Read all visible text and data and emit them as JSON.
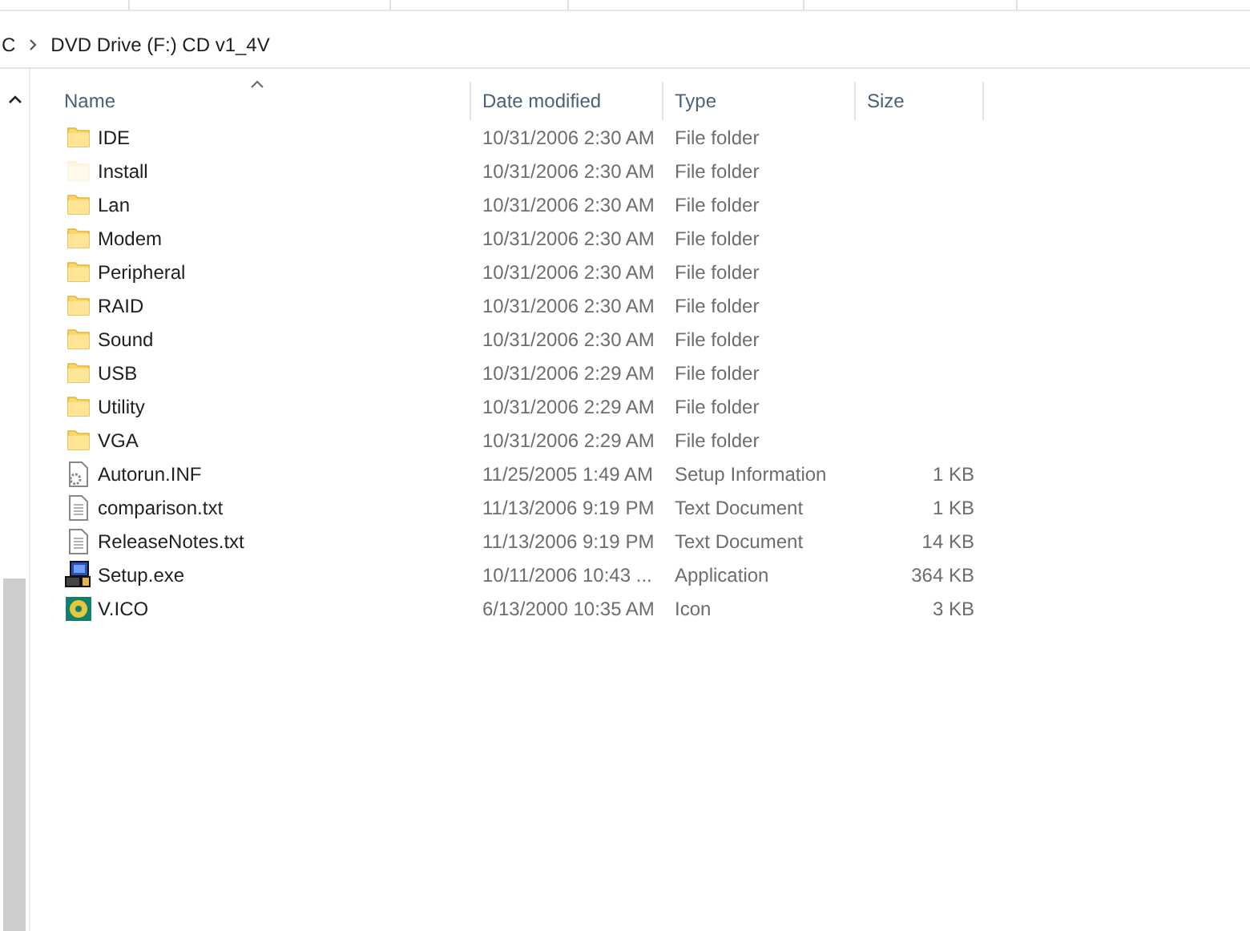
{
  "address_bar": {
    "segments": [
      "C",
      "DVD Drive (F:) CD v1_4V"
    ]
  },
  "columns": [
    {
      "label": "Name",
      "sorted": true
    },
    {
      "label": "Date modified",
      "sorted": false
    },
    {
      "label": "Type",
      "sorted": false
    },
    {
      "label": "Size",
      "sorted": false
    }
  ],
  "files": [
    {
      "kind": "folder",
      "name": "IDE",
      "date": "10/31/2006 2:30 AM",
      "type": "File folder",
      "hidden": false
    },
    {
      "kind": "folder",
      "name": "Install",
      "date": "10/31/2006 2:30 AM",
      "type": "File folder",
      "hidden": true
    },
    {
      "kind": "folder",
      "name": "Lan",
      "date": "10/31/2006 2:30 AM",
      "type": "File folder",
      "hidden": false
    },
    {
      "kind": "folder",
      "name": "Modem",
      "date": "10/31/2006 2:30 AM",
      "type": "File folder",
      "hidden": false
    },
    {
      "kind": "folder",
      "name": "Peripheral",
      "date": "10/31/2006 2:30 AM",
      "type": "File folder",
      "hidden": false
    },
    {
      "kind": "folder",
      "name": "RAID",
      "date": "10/31/2006 2:30 AM",
      "type": "File folder",
      "hidden": false
    },
    {
      "kind": "folder",
      "name": "Sound",
      "date": "10/31/2006 2:30 AM",
      "type": "File folder",
      "hidden": false
    },
    {
      "kind": "folder",
      "name": "USB",
      "date": "10/31/2006 2:29 AM",
      "type": "File folder",
      "hidden": false
    },
    {
      "kind": "folder",
      "name": "Utility",
      "date": "10/31/2006 2:29 AM",
      "type": "File folder",
      "hidden": false
    },
    {
      "kind": "folder",
      "name": "VGA",
      "date": "10/31/2006 2:29 AM",
      "type": "File folder",
      "hidden": false
    },
    {
      "kind": "settings",
      "name": "Autorun.INF",
      "date": "11/25/2005 1:49 AM",
      "type": "Setup Information",
      "size": "1 KB",
      "hidden": false
    },
    {
      "kind": "text",
      "name": "comparison.txt",
      "date": "11/13/2006 9:19 PM",
      "type": "Text Document",
      "size": "1 KB",
      "hidden": false
    },
    {
      "kind": "text",
      "name": "ReleaseNotes.txt",
      "date": "11/13/2006 9:19 PM",
      "type": "Text Document",
      "size": "14 KB",
      "hidden": false
    },
    {
      "kind": "app",
      "name": "Setup.exe",
      "date": "10/11/2006 10:43 ...",
      "type": "Application",
      "size": "364 KB",
      "hidden": false
    },
    {
      "kind": "icon",
      "name": "V.ICO",
      "date": "6/13/2000 10:35 AM",
      "type": "Icon",
      "size": "3 KB",
      "hidden": false
    }
  ]
}
